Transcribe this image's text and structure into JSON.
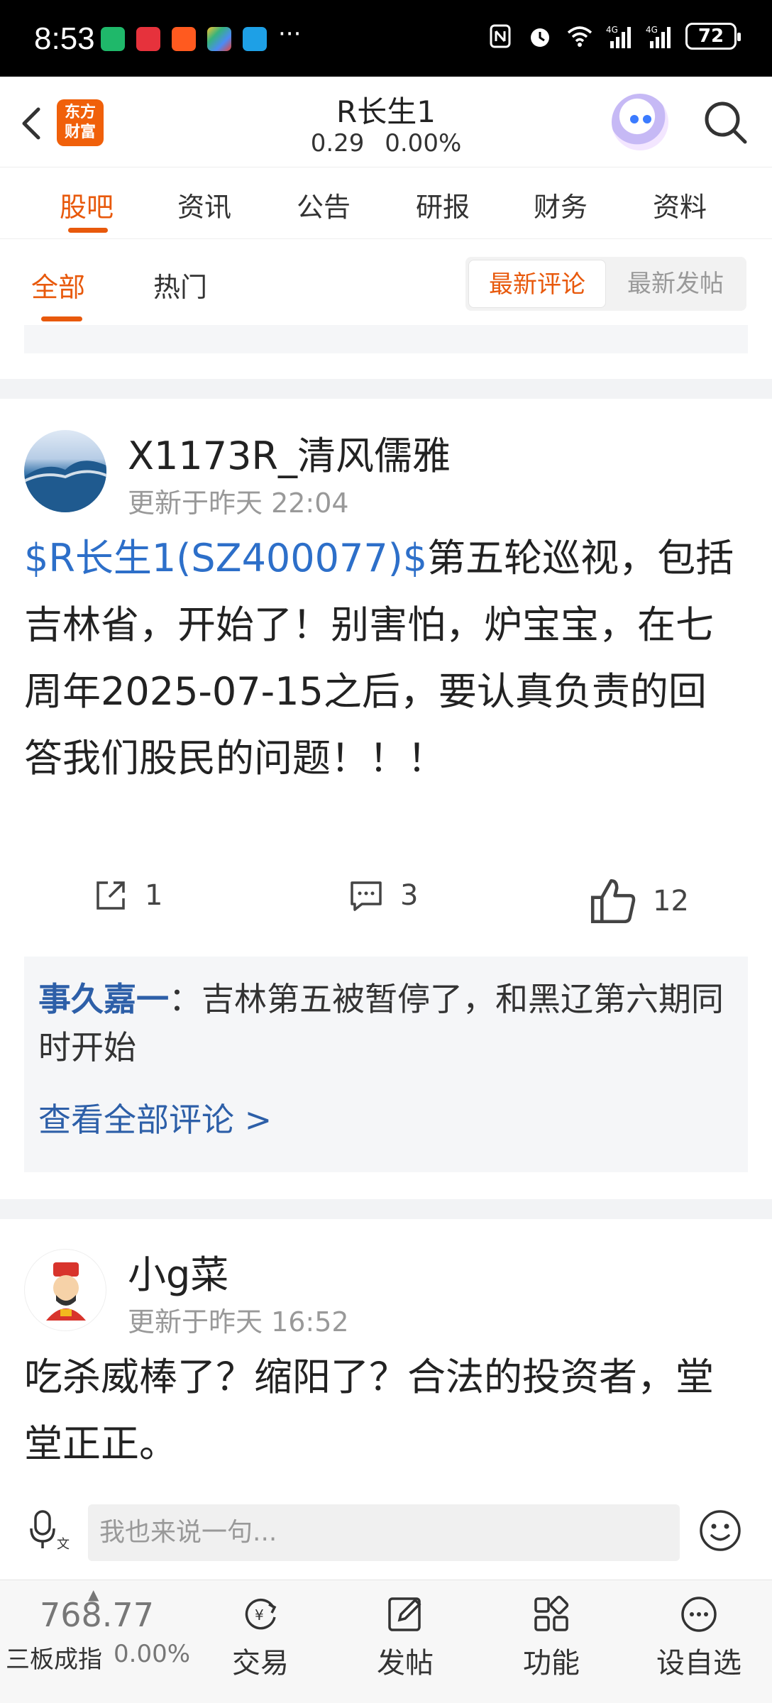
{
  "status_bar": {
    "time": "8:53",
    "battery": "72"
  },
  "header": {
    "logo_line1": "东方",
    "logo_line2": "财富",
    "stock_name": "R长生1",
    "stock_quote": "0.29 0.00%"
  },
  "tabs": [
    "股吧",
    "资讯",
    "公告",
    "研报",
    "财务",
    "资料"
  ],
  "subtabs": {
    "all": "全部",
    "hot": "热门",
    "latest_comment": "最新评论",
    "latest_post": "最新发帖"
  },
  "posts": [
    {
      "author": "X1173R_清风儒雅",
      "time": "更新于昨天 22:04",
      "stock_tag": "$R长生1(SZ400077)$",
      "text": "第五轮巡视，包括吉林省，开始了！别害怕，炉宝宝，在七周年2025-07-15之后，要认真负责的回答我们股民的问题！！！",
      "shares": "1",
      "comments": "3",
      "likes": "12",
      "top_comment_user": "事久嘉一",
      "top_comment_text": "：吉林第五被暂停了，和黑辽第六期同时开始",
      "view_all": "查看全部评论 >"
    },
    {
      "author": "小g菜",
      "time": "更新于昨天 16:52",
      "text": "吃杀威棒了？缩阳了？合法的投资者，堂堂正正。"
    }
  ],
  "input": {
    "placeholder": "我也来说一句..."
  },
  "bottom_nav": {
    "index_value": "768.77",
    "index_name": "三板成指",
    "index_change": "0.00%",
    "items": [
      "交易",
      "发帖",
      "功能",
      "设自选"
    ]
  },
  "colors": {
    "accent": "#e8590c",
    "link": "#2d6fc9",
    "comment_user": "#2d5fa8"
  }
}
